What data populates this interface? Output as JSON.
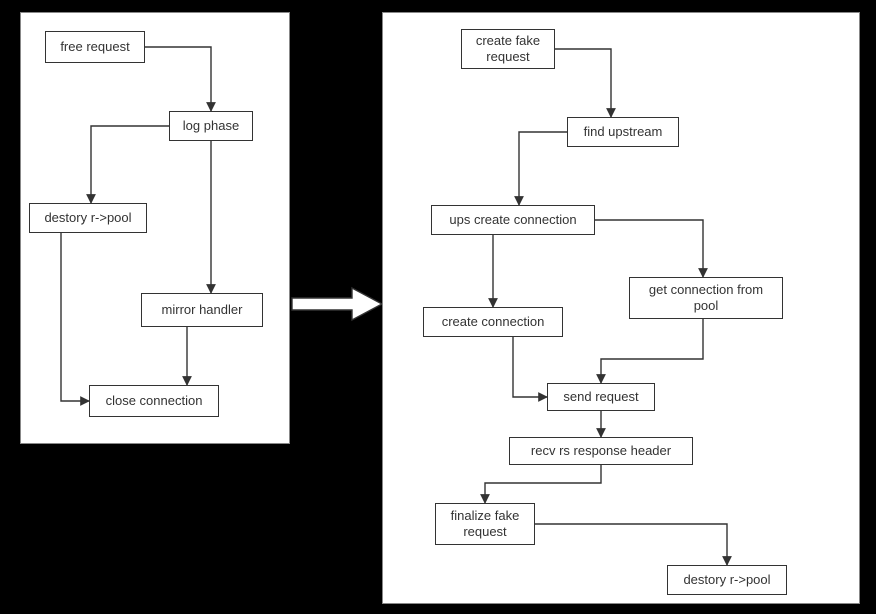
{
  "left": {
    "nodes": {
      "free_request": "free request",
      "log_phase": "log phase",
      "destroy_pool": "destory r->pool",
      "mirror_handler": "mirror handler",
      "close_connection": "close connection"
    }
  },
  "right": {
    "nodes": {
      "create_fake_request": "create fake\nrequest",
      "find_upstream": "find upstream",
      "ups_create_connection": "ups create connection",
      "create_connection": "create connection",
      "get_connection_from_pool": "get connection from\npool",
      "send_request": "send request",
      "recv_rs_response_header": "recv rs response header",
      "finalize_fake_request": "finalize fake\nrequest",
      "destroy_pool": "destory r->pool"
    }
  },
  "chart_data": {
    "type": "flowchart",
    "title": "",
    "panels": [
      {
        "id": "left",
        "nodes": [
          {
            "id": "free_request",
            "label": "free request"
          },
          {
            "id": "log_phase",
            "label": "log phase"
          },
          {
            "id": "destroy_pool",
            "label": "destory r->pool"
          },
          {
            "id": "mirror_handler",
            "label": "mirror handler"
          },
          {
            "id": "close_connection",
            "label": "close connection"
          }
        ],
        "edges": [
          {
            "from": "free_request",
            "to": "log_phase"
          },
          {
            "from": "log_phase",
            "to": "destroy_pool"
          },
          {
            "from": "log_phase",
            "to": "mirror_handler"
          },
          {
            "from": "mirror_handler",
            "to": "close_connection"
          },
          {
            "from": "destroy_pool",
            "to": "close_connection"
          }
        ]
      },
      {
        "id": "right",
        "nodes": [
          {
            "id": "create_fake_request",
            "label": "create fake request"
          },
          {
            "id": "find_upstream",
            "label": "find upstream"
          },
          {
            "id": "ups_create_connection",
            "label": "ups create connection"
          },
          {
            "id": "create_connection",
            "label": "create connection"
          },
          {
            "id": "get_connection_from_pool",
            "label": "get connection from pool"
          },
          {
            "id": "send_request",
            "label": "send request"
          },
          {
            "id": "recv_rs_response_header",
            "label": "recv rs response header"
          },
          {
            "id": "finalize_fake_request",
            "label": "finalize fake request"
          },
          {
            "id": "destroy_pool",
            "label": "destory r->pool"
          }
        ],
        "edges": [
          {
            "from": "create_fake_request",
            "to": "find_upstream"
          },
          {
            "from": "find_upstream",
            "to": "ups_create_connection"
          },
          {
            "from": "ups_create_connection",
            "to": "create_connection"
          },
          {
            "from": "ups_create_connection",
            "to": "get_connection_from_pool"
          },
          {
            "from": "create_connection",
            "to": "send_request"
          },
          {
            "from": "get_connection_from_pool",
            "to": "send_request"
          },
          {
            "from": "send_request",
            "to": "recv_rs_response_header"
          },
          {
            "from": "recv_rs_response_header",
            "to": "finalize_fake_request"
          },
          {
            "from": "finalize_fake_request",
            "to": "destroy_pool"
          }
        ]
      }
    ],
    "cross_edges": [
      {
        "from": "left.mirror_handler",
        "to": "right"
      }
    ]
  }
}
